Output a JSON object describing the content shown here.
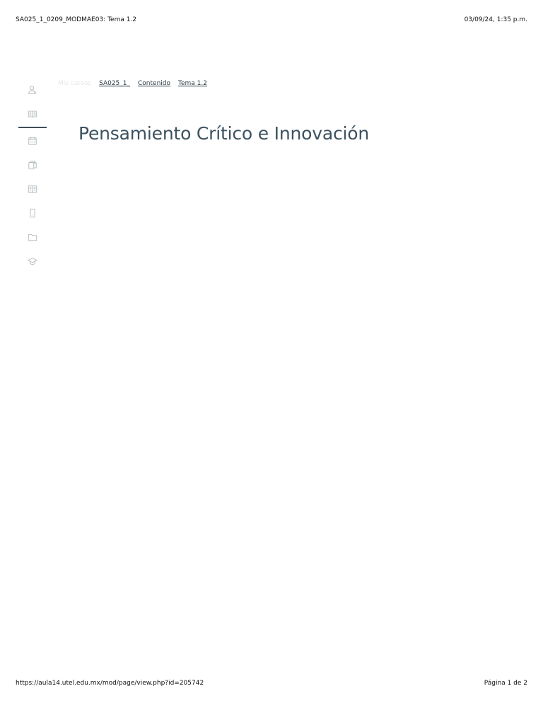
{
  "print_header": {
    "document_title": "SA025_1_0209_MODMAE03: Tema 1.2",
    "printed_at": "03/09/24, 1:35 p.m."
  },
  "breadcrumb": {
    "home": "Mis cursos",
    "items": [
      "SA025_1_",
      "Contenido",
      "Tema 1.2"
    ]
  },
  "page_title": "Pensamiento Crítico e Innovación",
  "sidebar": {
    "icons": [
      "user-icon",
      "book-icon",
      "calendar-icon",
      "documents-icon",
      "library-icon",
      "mobile-icon",
      "folder-icon",
      "graduation-cap-icon"
    ],
    "active_index": 1
  },
  "print_footer": {
    "url": "https://aula14.utel.edu.mx/mod/page/view.php?id=205742",
    "page": "Página 1 de 2"
  }
}
